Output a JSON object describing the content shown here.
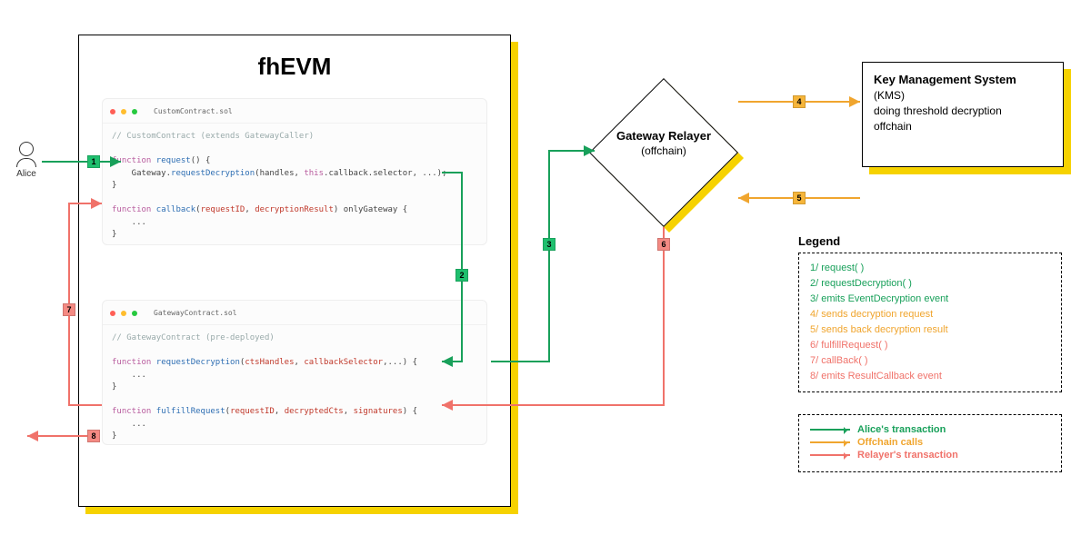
{
  "fhevm": {
    "title": "fhEVM"
  },
  "contracts": {
    "custom": {
      "filename": "CustomContract.sol",
      "comment": "// CustomContract (extends GatewayCaller)",
      "line1a": "function ",
      "line1b": "request",
      "line1c": "() {",
      "line2a": "    Gateway.",
      "line2b": "requestDecryption",
      "line2c": "(handles, ",
      "line2d": "this",
      "line2e": ".callback.selector, ...);",
      "line3": "}",
      "line4a": "function ",
      "line4b": "callback",
      "line4c": "(",
      "line4d": "requestID",
      "line4e": ", ",
      "line4f": "decryptionResult",
      "line4g": ") onlyGateway {",
      "line5": "    ...",
      "line6": "}"
    },
    "gateway": {
      "filename": "GatewayContract.sol",
      "comment": "// GatewayContract (pre-deployed)",
      "line1a": "function ",
      "line1b": "requestDecryption",
      "line1c": "(",
      "line1d": "ctsHandles",
      "line1e": ", ",
      "line1f": "callbackSelector",
      "line1g": ",...) {",
      "line2": "    ...",
      "line3": "}",
      "line4a": "function ",
      "line4b": "fulfillRequest",
      "line4c": "(",
      "line4d": "requestID",
      "line4e": ", ",
      "line4f": "decryptedCts",
      "line4g": ", ",
      "line4h": "signatures",
      "line4i": ") {",
      "line5": "    ...",
      "line6": "}"
    }
  },
  "alice": {
    "label": "Alice"
  },
  "relayer": {
    "title": "Gateway Relayer",
    "sub": "(offchain)"
  },
  "kms": {
    "title": "Key Management System",
    "line2": "(KMS)",
    "line3": "doing threshold decryption",
    "line4": "offchain"
  },
  "legend": {
    "title": "Legend",
    "items": [
      {
        "text": "1/ request( )",
        "cls": "lg-green"
      },
      {
        "text": "2/ requestDecryption( )",
        "cls": "lg-green"
      },
      {
        "text": "3/ emits EventDecryption event",
        "cls": "lg-green"
      },
      {
        "text": "4/ sends decryption request",
        "cls": "lg-orange"
      },
      {
        "text": "5/ sends back decryption result",
        "cls": "lg-orange"
      },
      {
        "text": "6/ fulfillRequest( )",
        "cls": "lg-red"
      },
      {
        "text": "7/ callBack( )",
        "cls": "lg-red"
      },
      {
        "text": "8/ emits ResultCallback event",
        "cls": "lg-red"
      }
    ],
    "arrows": [
      {
        "text": "Alice's transaction",
        "cls": "as-green",
        "tcls": "lr-green"
      },
      {
        "text": "Offchain calls",
        "cls": "as-orange",
        "tcls": "lr-orange"
      },
      {
        "text": "Relayer's transaction",
        "cls": "as-red",
        "tcls": "lr-red"
      }
    ]
  },
  "steps": {
    "s1": "1",
    "s2": "2",
    "s3": "3",
    "s4": "4",
    "s5": "5",
    "s6": "6",
    "s7": "7",
    "s8": "8"
  }
}
